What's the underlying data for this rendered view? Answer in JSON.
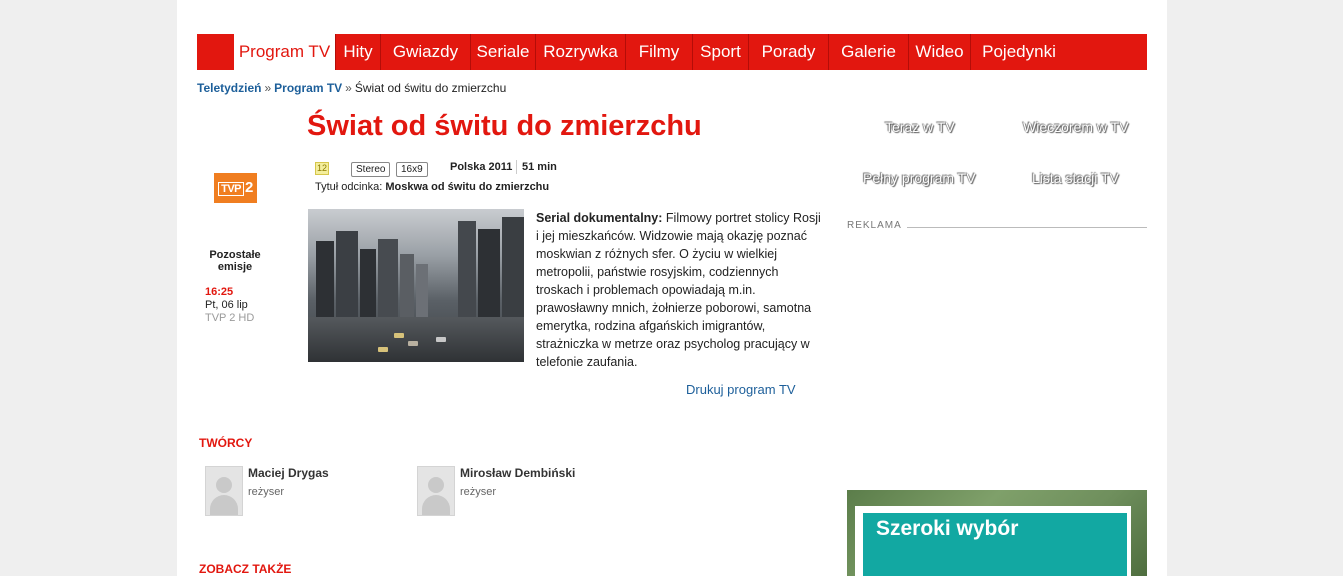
{
  "nav": {
    "items": [
      {
        "label": "Program TV",
        "active": true
      },
      {
        "label": "Hity"
      },
      {
        "label": "Gwiazdy"
      },
      {
        "label": "Seriale"
      },
      {
        "label": "Rozrywka"
      },
      {
        "label": "Filmy"
      },
      {
        "label": "Sport"
      },
      {
        "label": "Porady"
      },
      {
        "label": "Galerie"
      },
      {
        "label": "Wideo"
      },
      {
        "label": "Pojedynki"
      }
    ]
  },
  "breadcrumb": {
    "home": "Teletydzień",
    "section": "Program TV",
    "current": "Świat od świtu do zmierzchu",
    "separator": "»"
  },
  "show": {
    "title": "Świat od świtu do zmierzchu",
    "age_rating": "12",
    "audio": "Stereo",
    "aspect": "16x9",
    "country_year": "Polska 2011",
    "duration": "51 min",
    "episode_label": "Tytuł odcinka:",
    "episode_title": "Moskwa od świtu do zmierzchu",
    "genre": "Serial dokumentalny:",
    "description": "Filmowy portret stolicy Rosji i jej mieszkańców. Widzowie mają okazję poznać moskwian z różnych sfer. O życiu w wielkiej metropolii, państwie rosyjskim, codziennych troskach i problemach opowiadają m.in. prawosławny mnich, żołnierze poborowi, samotna emerytka, rodzina afgańskich imigrantów, strażniczka w metrze oraz psycholog pracujący w telefonie zaufania.",
    "print_link": "Drukuj program TV"
  },
  "channel": {
    "logo_text_1": "TVP",
    "logo_text_2": "2",
    "other_label": "Pozostałe emisje",
    "other_time": "16:25",
    "other_date": "Pt, 06 lip",
    "other_channel": "TVP 2 HD"
  },
  "creators": {
    "heading": "TWÓRCY",
    "people": [
      {
        "name": "Maciej Drygas",
        "role": "reżyser"
      },
      {
        "name": "Mirosław Dembiński",
        "role": "reżyser"
      }
    ]
  },
  "see_also": {
    "heading": "ZOBACZ TAKŻE"
  },
  "sidebar": {
    "links": [
      "Teraz w TV",
      "Wieczorem w TV",
      "Pełny program TV",
      "Lista stacji TV"
    ],
    "ad_label": "REKLAMA",
    "promo_text": "Szeroki wybór"
  },
  "colors": {
    "brand_red": "#e2170f",
    "link_blue": "#1d5f9a",
    "promo_teal": "#12a8a2",
    "channel_orange": "#f07e20"
  }
}
